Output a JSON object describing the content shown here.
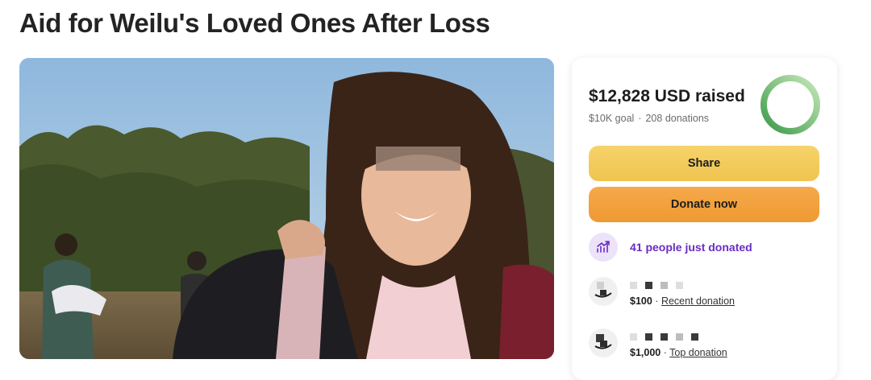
{
  "page": {
    "title": "Aid for Weilu's Loved Ones After Loss"
  },
  "progress": {
    "raised_amount": "$12,828",
    "raised_suffix": "USD raised",
    "goal": "$10K goal",
    "donations": "208 donations",
    "fraction": 1.0,
    "ring_color": "#3c9a4a"
  },
  "buttons": {
    "share": "Share",
    "donate": "Donate now"
  },
  "activity": {
    "recent_count_text": "41 people just donated"
  },
  "donors": [
    {
      "amount": "$100",
      "separator": "·",
      "tag": "Recent donation"
    },
    {
      "amount": "$1,000",
      "separator": "·",
      "tag": "Top donation"
    }
  ],
  "colors": {
    "share_bg": "#f2cb5c",
    "donate_bg": "#f2a13e",
    "accent_purple": "#6a2cc4"
  }
}
